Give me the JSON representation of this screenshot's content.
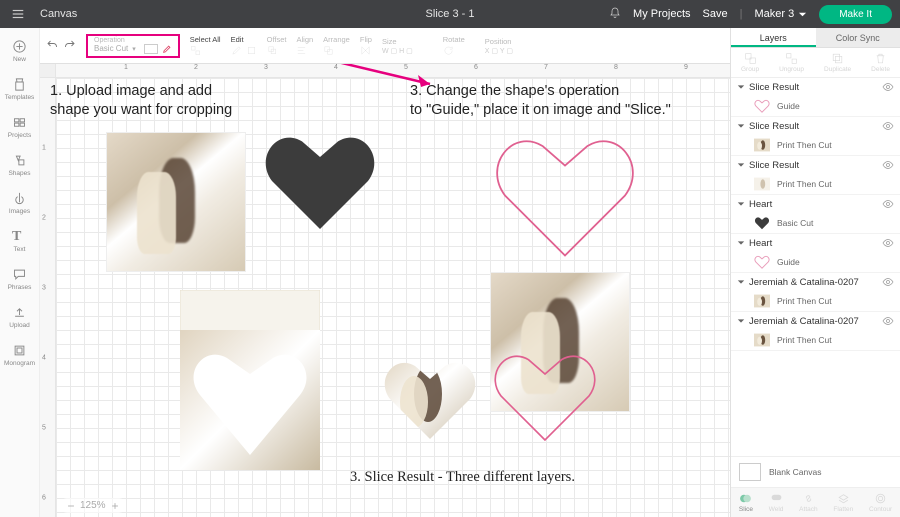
{
  "topbar": {
    "app_title": "Canvas",
    "doc_title": "Slice 3 - 1",
    "my_projects": "My Projects",
    "save": "Save",
    "maker": "Maker 3",
    "make_it": "Make It"
  },
  "toolbar": {
    "operation_label": "Operation",
    "basic_cut": "Basic Cut",
    "select_all": "Select All",
    "edit": "Edit",
    "offset": "Offset",
    "align": "Align",
    "arrange": "Arrange",
    "flip": "Flip",
    "size": "Size",
    "rotate": "Rotate",
    "position": "Position"
  },
  "left_rail": {
    "new": "New",
    "templates": "Templates",
    "projects": "Projects",
    "shapes": "Shapes",
    "images": "Images",
    "text": "Text",
    "phrases": "Phrases",
    "upload": "Upload",
    "monogram": "Monogram"
  },
  "right_panel": {
    "tab_layers": "Layers",
    "tab_color_sync": "Color Sync",
    "actions": {
      "group": "Group",
      "ungroup": "Ungroup",
      "duplicate": "Duplicate",
      "delete": "Delete"
    },
    "blank_canvas": "Blank Canvas",
    "bottom": {
      "slice": "Slice",
      "weld": "Weld",
      "attach": "Attach",
      "flatten": "Flatten",
      "contour": "Contour"
    },
    "layers": [
      {
        "name": "Slice Result",
        "children": [
          {
            "op": "Guide",
            "thumb": "heart-outline-pink"
          }
        ]
      },
      {
        "name": "Slice Result",
        "children": [
          {
            "op": "Print Then Cut",
            "thumb": "photo"
          }
        ]
      },
      {
        "name": "Slice Result",
        "children": [
          {
            "op": "Print Then Cut",
            "thumb": "photo-faint"
          }
        ]
      },
      {
        "name": "Heart",
        "children": [
          {
            "op": "Basic Cut",
            "thumb": "heart-solid"
          }
        ]
      },
      {
        "name": "Heart",
        "children": [
          {
            "op": "Guide",
            "thumb": "heart-outline-pink"
          }
        ]
      },
      {
        "name": "Jeremiah & Catalina-0207",
        "children": [
          {
            "op": "Print Then Cut",
            "thumb": "photo"
          }
        ]
      },
      {
        "name": "Jeremiah & Catalina-0207",
        "children": [
          {
            "op": "Print Then Cut",
            "thumb": "photo"
          }
        ]
      }
    ]
  },
  "rulers": {
    "h_ticks": [
      "1",
      "2",
      "3",
      "4",
      "5",
      "6",
      "7",
      "8",
      "9"
    ],
    "v_ticks": [
      "1",
      "2",
      "3",
      "4",
      "5",
      "6"
    ]
  },
  "zoom": {
    "value": "125%"
  },
  "annotations": {
    "a1_l1": "1. Upload image and add",
    "a1_l2": "shape you want for cropping",
    "a3_l1": "3. Change the shape's operation",
    "a3_l2": "to \"Guide,\" place it on image and \"Slice.\"",
    "a_bottom": "3. Slice Result - Three different layers."
  }
}
